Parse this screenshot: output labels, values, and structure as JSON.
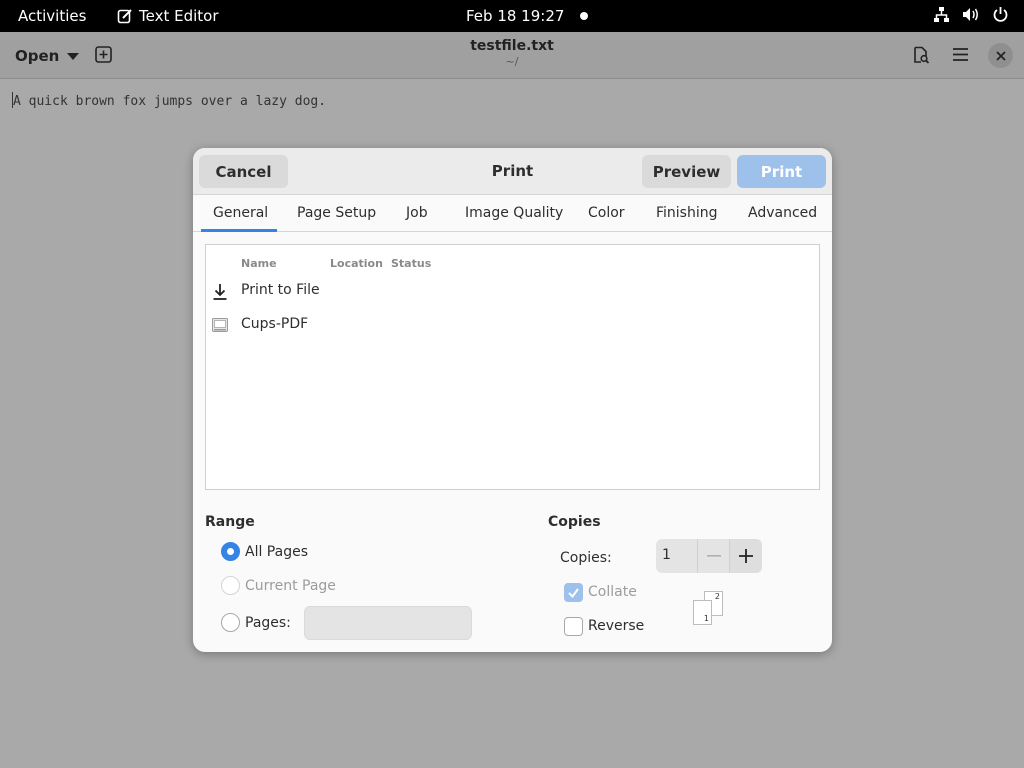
{
  "topbar": {
    "activities": "Activities",
    "app_name": "Text Editor",
    "clock": "Feb 18  19:27"
  },
  "editor": {
    "open_label": "Open",
    "title": "testfile.txt",
    "subtitle": "~/",
    "content": "A quick brown fox jumps over a lazy dog."
  },
  "dialog": {
    "title": "Print",
    "cancel": "Cancel",
    "preview": "Preview",
    "print": "Print",
    "tabs": [
      "General",
      "Page Setup",
      "Job",
      "Image Quality",
      "Color",
      "Finishing",
      "Advanced"
    ],
    "active_tab": "General",
    "list_columns": [
      "Name",
      "Location",
      "Status"
    ],
    "printers": [
      {
        "name": "Print to File",
        "icon": "download-icon"
      },
      {
        "name": "Cups-PDF",
        "icon": "printer-icon"
      }
    ],
    "range": {
      "title": "Range",
      "all_pages": "All Pages",
      "current_page": "Current Page",
      "pages": "Pages:",
      "pages_value": "",
      "selected": "All Pages"
    },
    "copies": {
      "title": "Copies",
      "label": "Copies:",
      "value": "1",
      "collate": "Collate",
      "collate_checked": true,
      "reverse": "Reverse",
      "reverse_checked": false,
      "sheet_front": "1",
      "sheet_back": "2"
    }
  },
  "colors": {
    "accent": "#3584e4",
    "print_button": "#9ec1ec"
  }
}
